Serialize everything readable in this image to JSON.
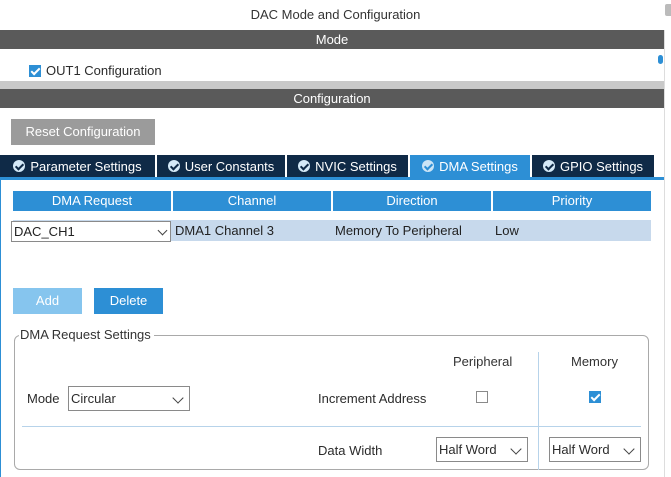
{
  "window": {
    "title": "DAC Mode and Configuration"
  },
  "mode_section": {
    "header": "Mode",
    "out1": {
      "label": "OUT1 Configuration",
      "checked": true
    }
  },
  "config_section": {
    "header": "Configuration",
    "reset_button": "Reset Configuration",
    "tabs": [
      {
        "label": "Parameter Settings",
        "icon": "check-circle-icon",
        "active": false
      },
      {
        "label": "User Constants",
        "icon": "check-circle-icon",
        "active": false
      },
      {
        "label": "NVIC Settings",
        "icon": "check-circle-icon",
        "active": false
      },
      {
        "label": "DMA Settings",
        "icon": "check-circle-icon",
        "active": true
      },
      {
        "label": "GPIO Settings",
        "icon": "check-circle-icon",
        "active": false
      }
    ]
  },
  "dma_table": {
    "columns": [
      "DMA Request",
      "Channel",
      "Direction",
      "Priority"
    ],
    "rows": [
      {
        "request": "DAC_CH1",
        "channel": "DMA1 Channel 3",
        "direction": "Memory To Peripheral",
        "priority": "Low"
      }
    ]
  },
  "actions": {
    "add": "Add",
    "delete": "Delete"
  },
  "dma_request_settings": {
    "title": "DMA Request Settings",
    "peripheral_header": "Peripheral",
    "memory_header": "Memory",
    "mode_label": "Mode",
    "mode_value": "Circular",
    "increment_label": "Increment Address",
    "increment_peripheral": false,
    "increment_memory": true,
    "data_width_label": "Data Width",
    "data_width_peripheral": "Half Word",
    "data_width_memory": "Half Word"
  },
  "colors": {
    "accent": "#2d8fd5",
    "tab_inactive": "#0f2a47",
    "section_header": "#5a5a5a",
    "row_highlight": "#c7d9ec"
  }
}
